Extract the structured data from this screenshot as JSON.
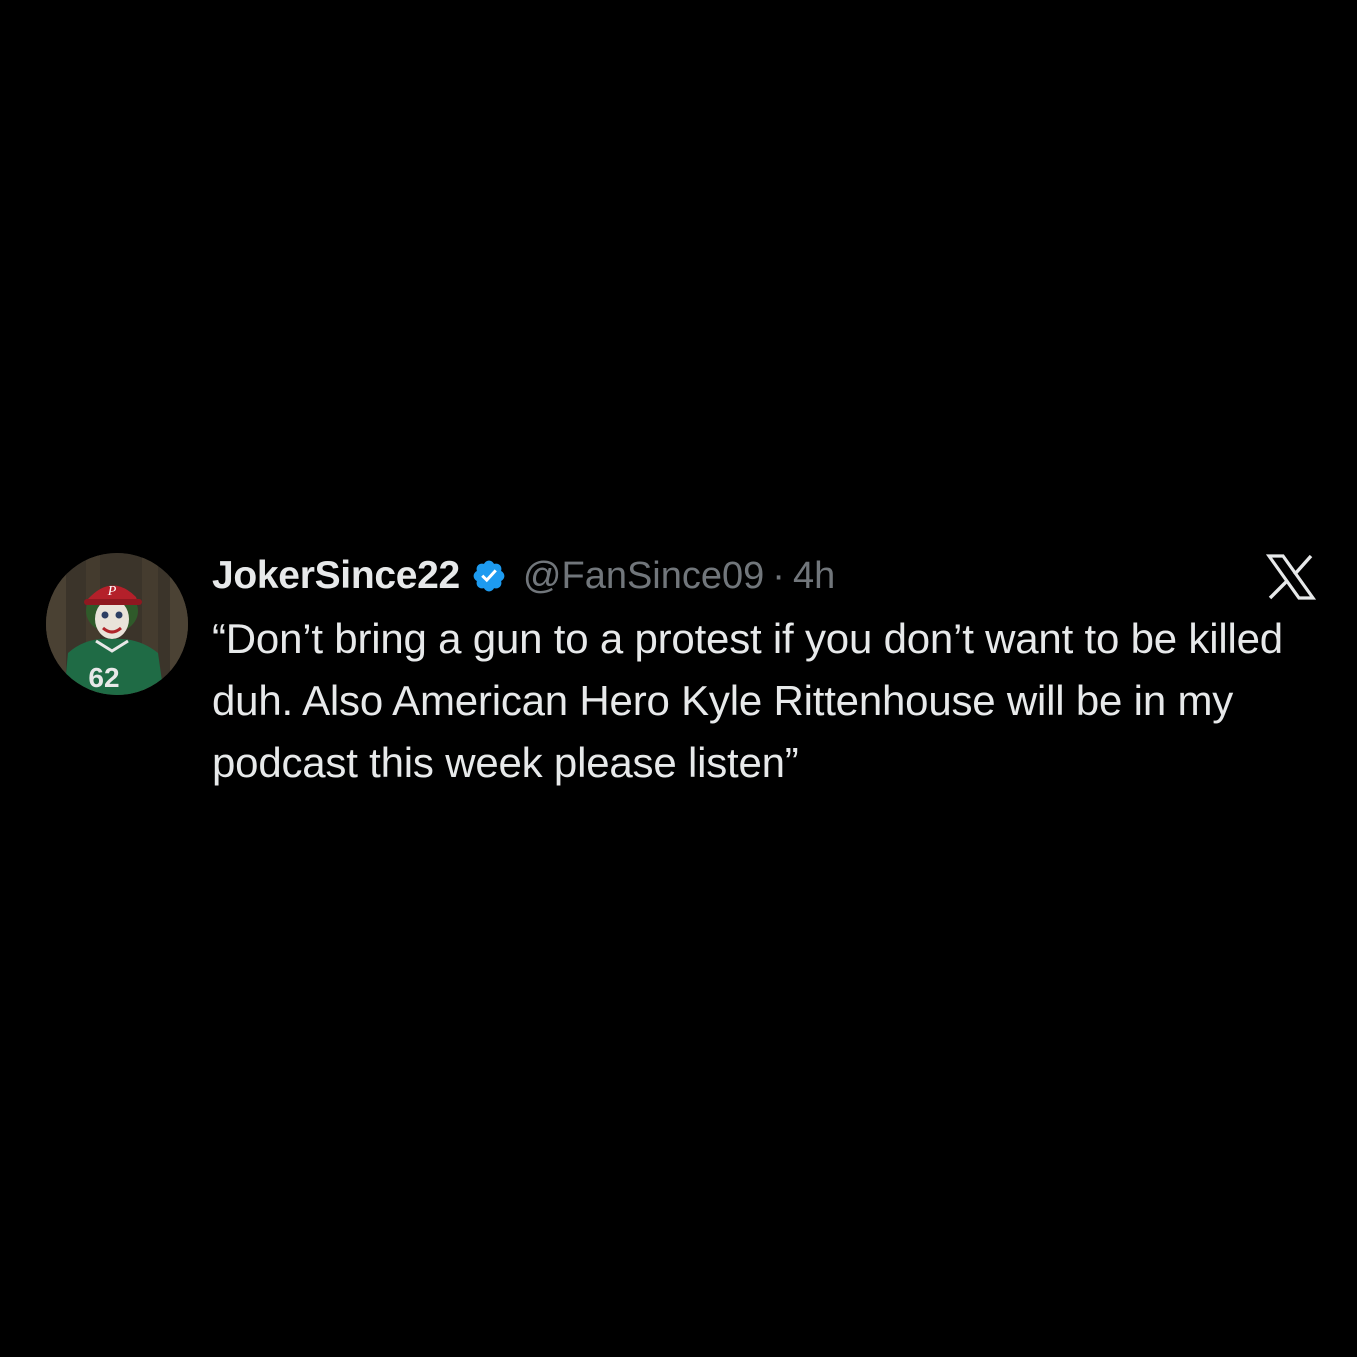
{
  "tweet": {
    "display_name": "JokerSince22",
    "verified": true,
    "handle": "@FanSince09",
    "separator": "·",
    "time": "4h",
    "text": "“Don’t bring a gun to a protest if you don’t want to be killed duh. Also American Hero Kyle Rittenhouse will be in my podcast this week please listen”",
    "avatar_jersey_number": "62",
    "avatar_cap_letter": "P"
  },
  "colors": {
    "background": "#000000",
    "primary_text": "#e7e9ea",
    "secondary_text": "#71767b",
    "verified_badge": "#1d9bf0"
  },
  "icons": {
    "verified": "verified-badge-icon",
    "brand": "x-logo-icon"
  }
}
